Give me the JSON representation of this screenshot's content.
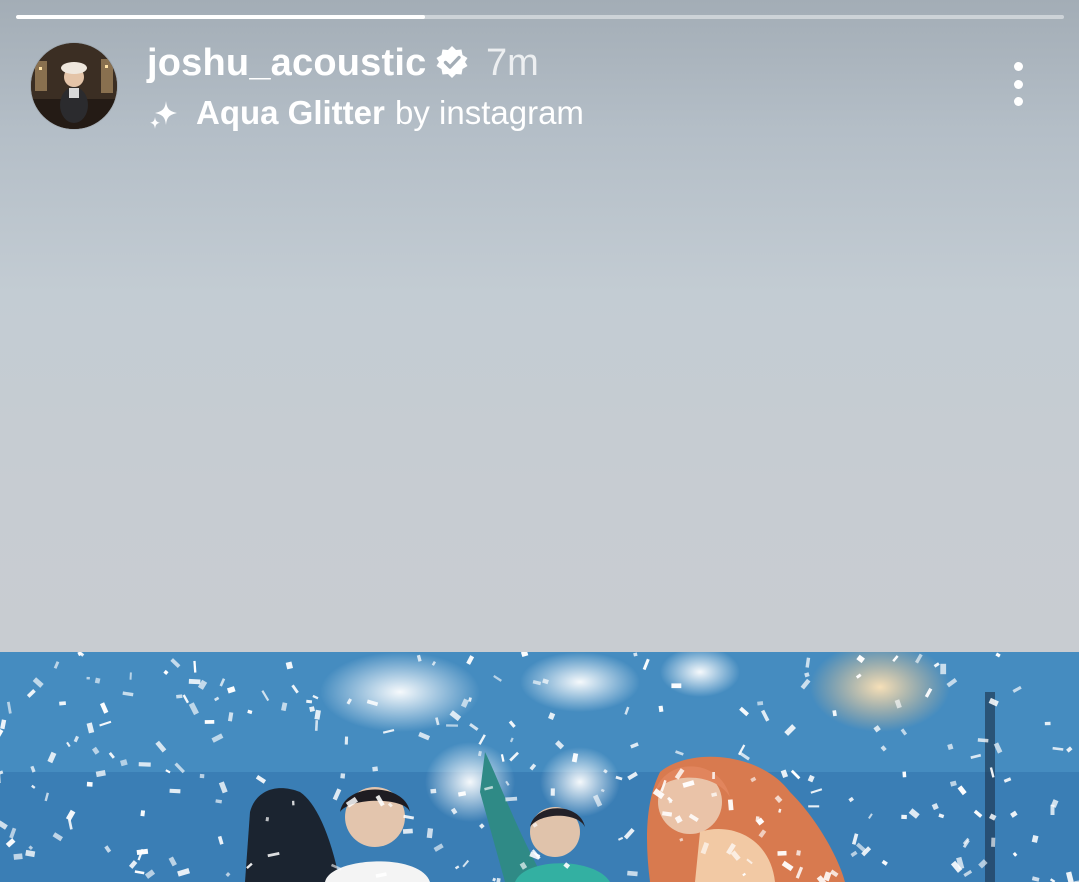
{
  "story": {
    "progress": 0.39,
    "username": "joshu_acoustic",
    "verified": true,
    "time_ago": "7m",
    "effect": {
      "name": "Aqua Glitter",
      "by": "by instagram"
    }
  },
  "icons": {
    "verified": "verified-badge-icon",
    "effect": "sparkle-icon",
    "more": "more-vertical-icon"
  },
  "colors": {
    "background_top": "#a3adb6",
    "background_bottom": "#c8ccd1",
    "text": "#ffffff",
    "photo_blue": "#3d86bd"
  }
}
